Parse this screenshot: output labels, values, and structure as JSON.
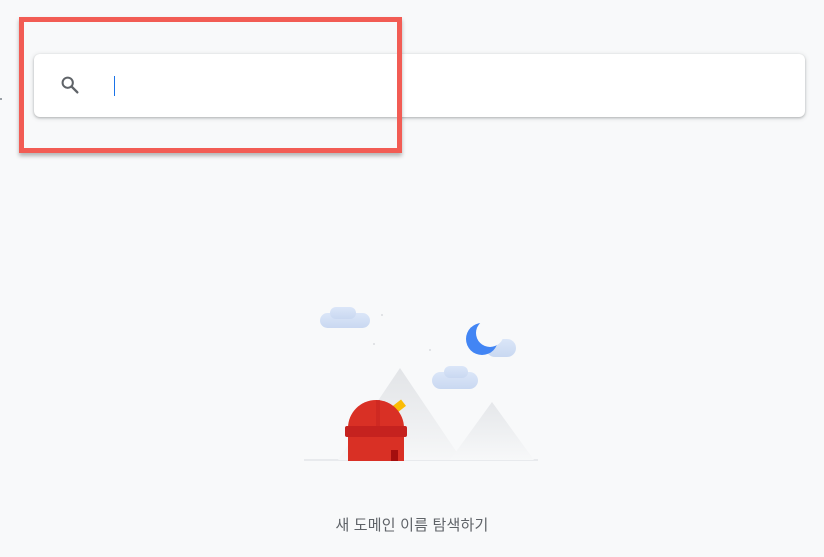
{
  "search": {
    "value": "",
    "placeholder": ""
  },
  "empty_state": {
    "caption": "새 도메인 이름 탐색하기"
  },
  "icons": {
    "search": "search-icon",
    "illustration": "observatory-illustration"
  },
  "colors": {
    "page_background": "#f8f9fa",
    "card_background": "#ffffff",
    "highlight_border": "#f25c54",
    "caret": "#1a73e8",
    "observatory_red": "#d93025",
    "moon_blue": "#4285f4",
    "text_secondary": "#5f6368"
  }
}
